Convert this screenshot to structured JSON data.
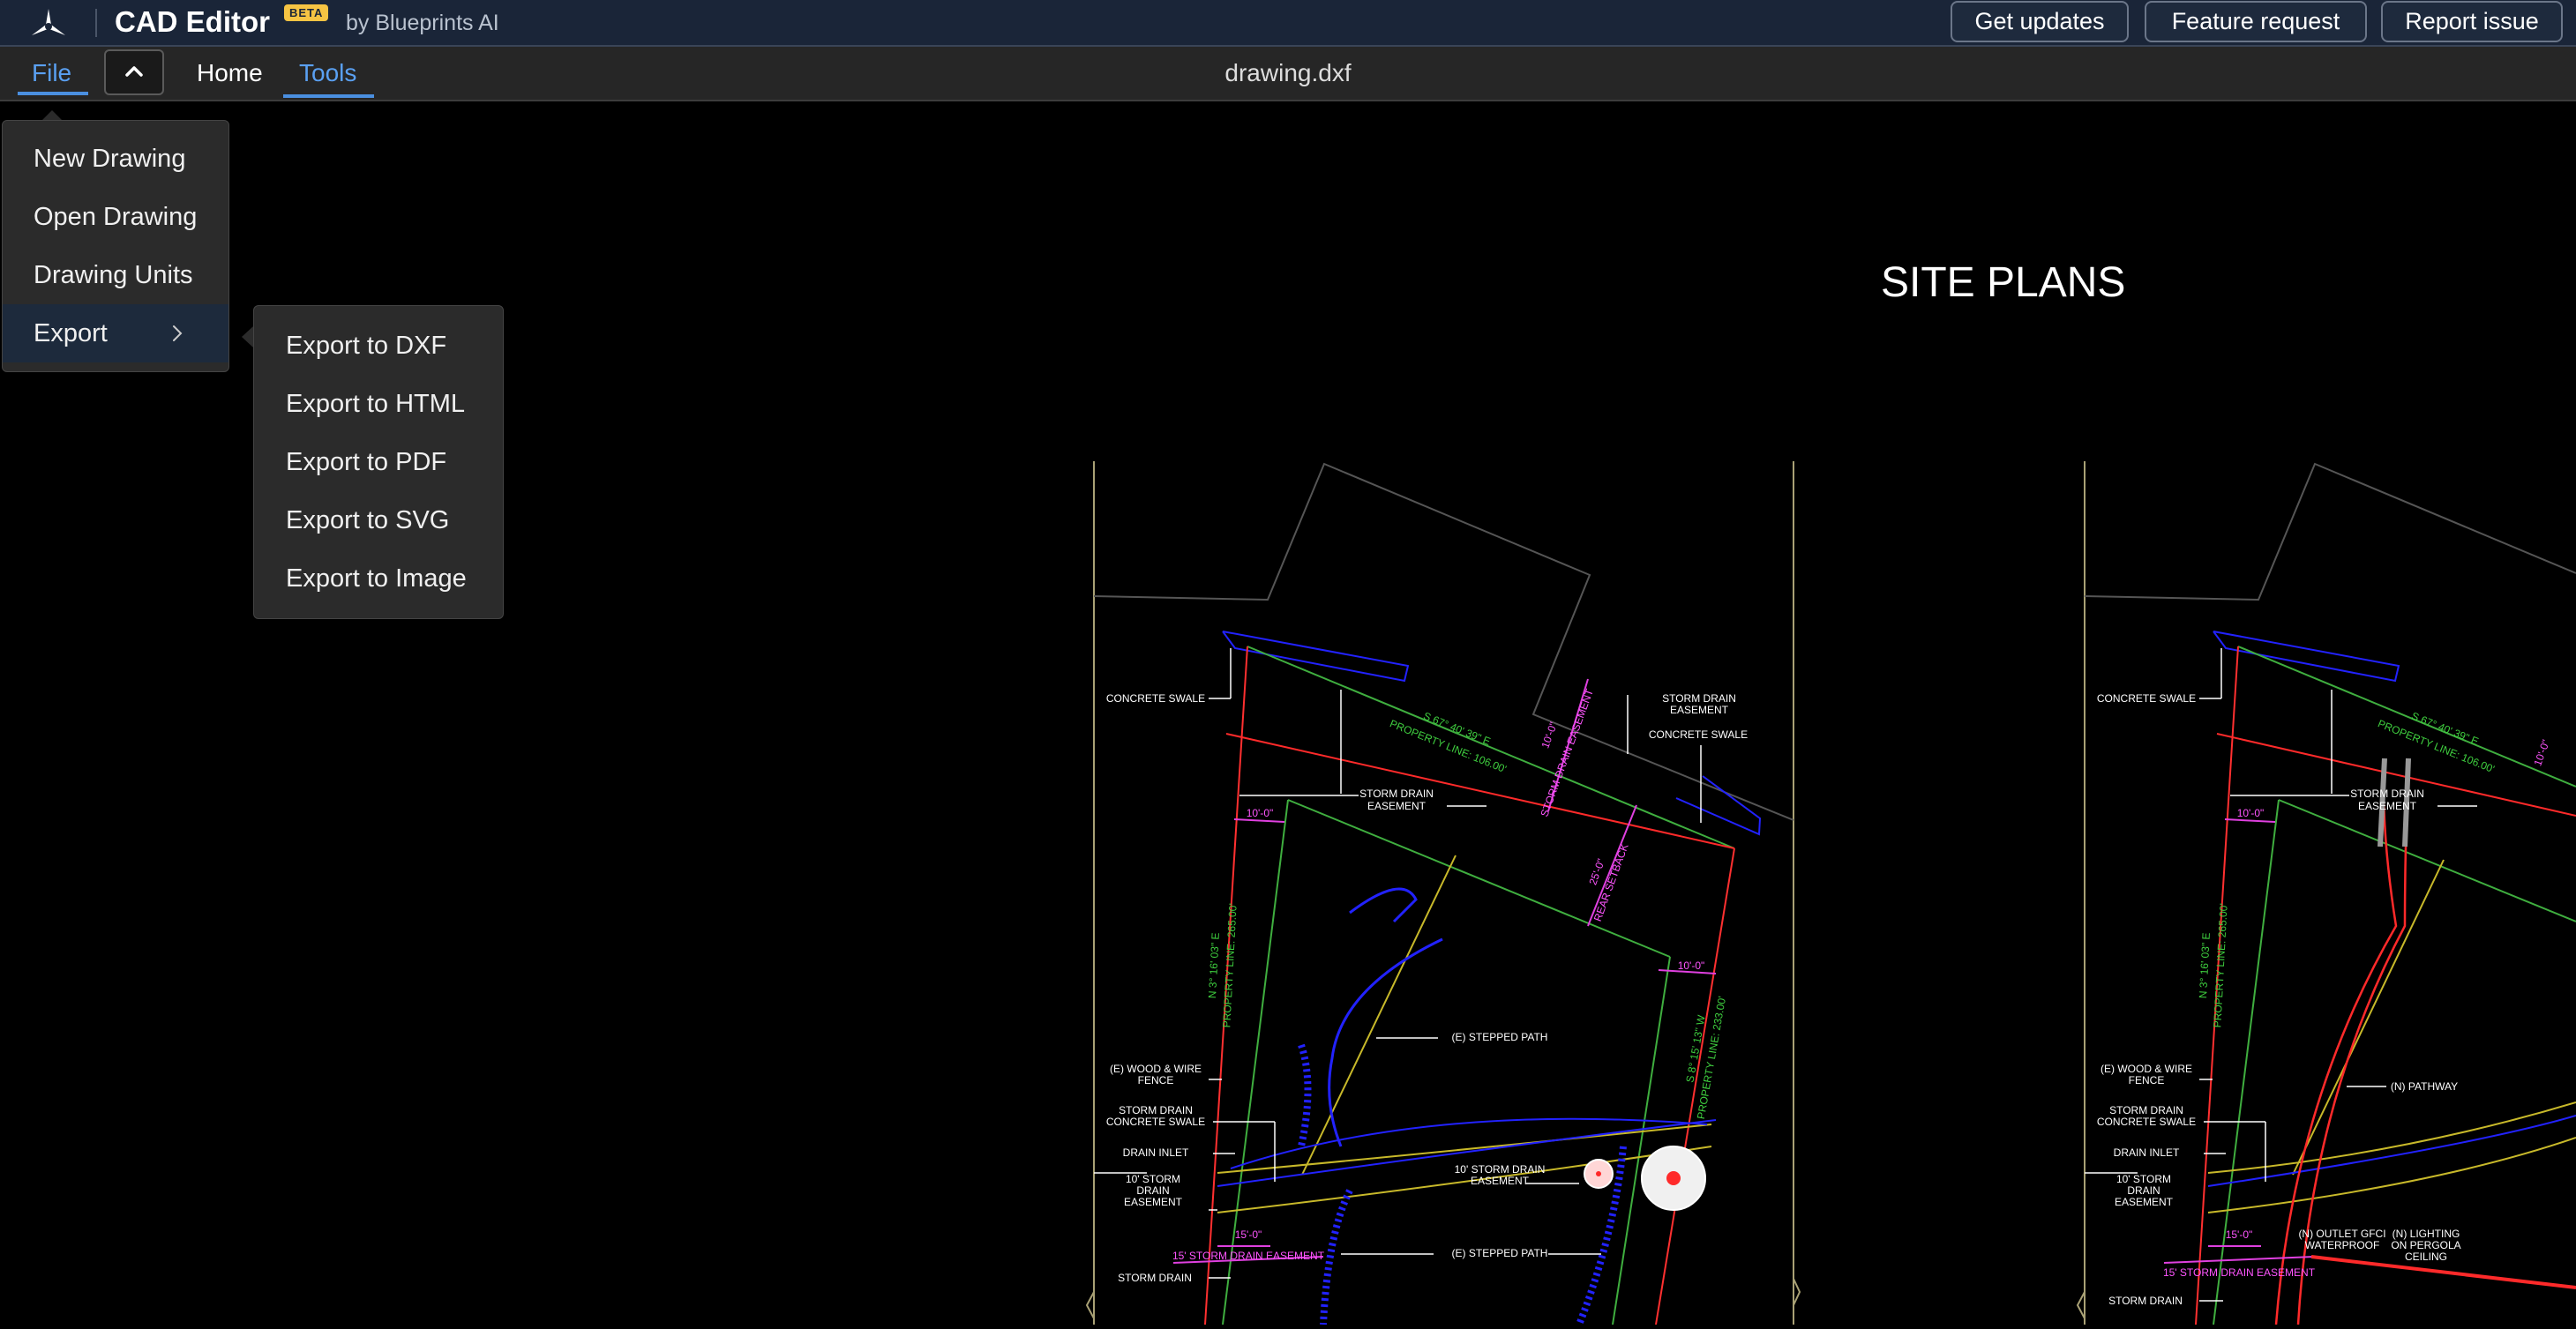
{
  "header": {
    "app_title": "CAD Editor",
    "beta_badge": "BETA",
    "byline": "by Blueprints AI",
    "logo_icon": "blueprints-logo-icon",
    "buttons": [
      "Get updates",
      "Feature request",
      "Report issue"
    ]
  },
  "menubar": {
    "tabs": [
      "File",
      "Home",
      "Tools"
    ],
    "active_tabs": [
      "File",
      "Tools"
    ],
    "collapse_icon": "chevron-up-icon",
    "filename": "drawing.dxf"
  },
  "file_menu": {
    "items": [
      "New Drawing",
      "Open Drawing",
      "Drawing Units",
      "Export"
    ],
    "submenu_icon": "chevron-right-icon"
  },
  "export_menu": {
    "items": [
      "Export to DXF",
      "Export to HTML",
      "Export to PDF",
      "Export to SVG",
      "Export to Image"
    ]
  },
  "canvas": {
    "title": "SITE PLANS",
    "left_plan_labels": [
      "CONCRETE SWALE",
      "STORM DRAIN",
      "EASEMENT",
      "CONCRETE SWALE",
      "S 67° 40' 39\" E",
      "PROPERTY LINE: 106.00'",
      "10'-0\"",
      "STORM DRAIN EASEMENT",
      "STORM DRAIN",
      "EASEMENT",
      "10'-0\"",
      "25'-0\"",
      "REAR SETBACK",
      "10'-0\"",
      "N 3° 16' 03\" E",
      "PROPERTY LINE: 265.00'",
      "S 8° 15' 13\" W",
      "PROPERTY LINE: 233.00'",
      "(E) STEPPED PATH",
      "(E) WOOD & WIRE",
      "FENCE",
      "STORM DRAIN",
      "CONCRETE SWALE",
      "DRAIN INLET",
      "10' STORM",
      "DRAIN",
      "EASEMENT",
      "10' STORM DRAIN",
      "EASEMENT",
      "15'-0\"",
      "15' STORM DRAIN EASEMENT",
      "(E) STEPPED PATH",
      "STORM DRAIN"
    ],
    "right_plan_labels": [
      "CONCRETE SWALE",
      "S 67° 40' 39\" E",
      "PROPERTY LINE: 106.00'",
      "10'-0\"",
      "STORM DRAIN",
      "EASEMENT",
      "10'-0\"",
      "N 3° 16' 03\" E",
      "PROPERTY LINE: 265.00'",
      "(N) PATHWAY",
      "(E) WOOD & WIRE",
      "FENCE",
      "STORM DRAIN",
      "CONCRETE SWALE",
      "DRAIN INLET",
      "10' STORM",
      "DRAIN",
      "EASEMENT",
      "15'-0\"",
      "15' STORM DRAIN EASEMENT",
      "(N) OUTLET GFCI",
      "WATERPROOF",
      "(N) LIGHTING",
      "ON PERGOLA",
      "CEILING",
      "STORM DRAIN"
    ]
  }
}
